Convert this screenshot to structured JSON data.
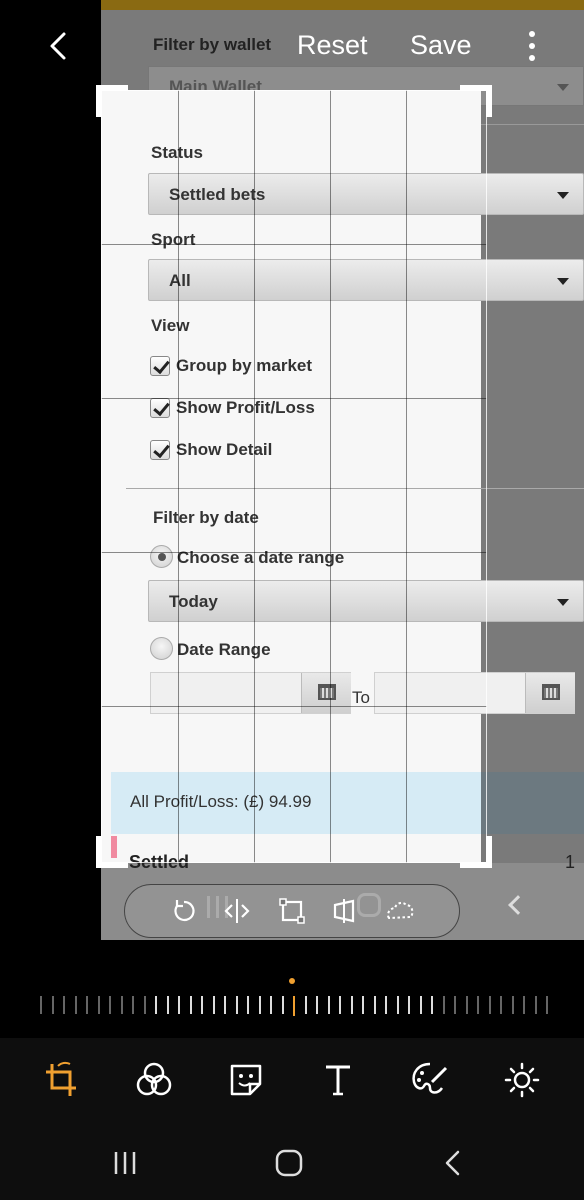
{
  "header": {
    "back_icon": "chevron-left-icon",
    "reset_label": "Reset",
    "save_label": "Save",
    "more_icon": "more-vertical-icon"
  },
  "photo": {
    "wallet": {
      "label": "Filter by wallet",
      "value": "Main Wallet"
    },
    "status": {
      "label": "Status",
      "value": "Settled bets"
    },
    "sport": {
      "label": "Sport",
      "value": "All"
    },
    "view": {
      "label": "View",
      "options": [
        {
          "label": "Group by market",
          "checked": true
        },
        {
          "label": "Show Profit/Loss",
          "checked": true
        },
        {
          "label": "Show Detail",
          "checked": true
        }
      ]
    },
    "date_filter": {
      "label": "Filter by date",
      "choose_range_label": "Choose a date range",
      "range_value": "Today",
      "date_range_label": "Date Range",
      "to_label": "To"
    },
    "profit_loss": "All Profit/Loss: (£) 94.99",
    "settled_label": "Settled",
    "settled_count": "1"
  },
  "pill_tools": [
    "rotate-icon",
    "flip-icon",
    "free-crop-icon",
    "perspective-icon",
    "lasso-icon"
  ],
  "bottom_tools": [
    "crop-icon",
    "filters-icon",
    "sticker-icon",
    "text-icon",
    "draw-icon",
    "brightness-icon"
  ],
  "colors": {
    "accent": "#f0a030",
    "background": "#000000",
    "toolbar": "#0e0e0e"
  },
  "ruler": {
    "value": 0,
    "ticks": 45
  }
}
